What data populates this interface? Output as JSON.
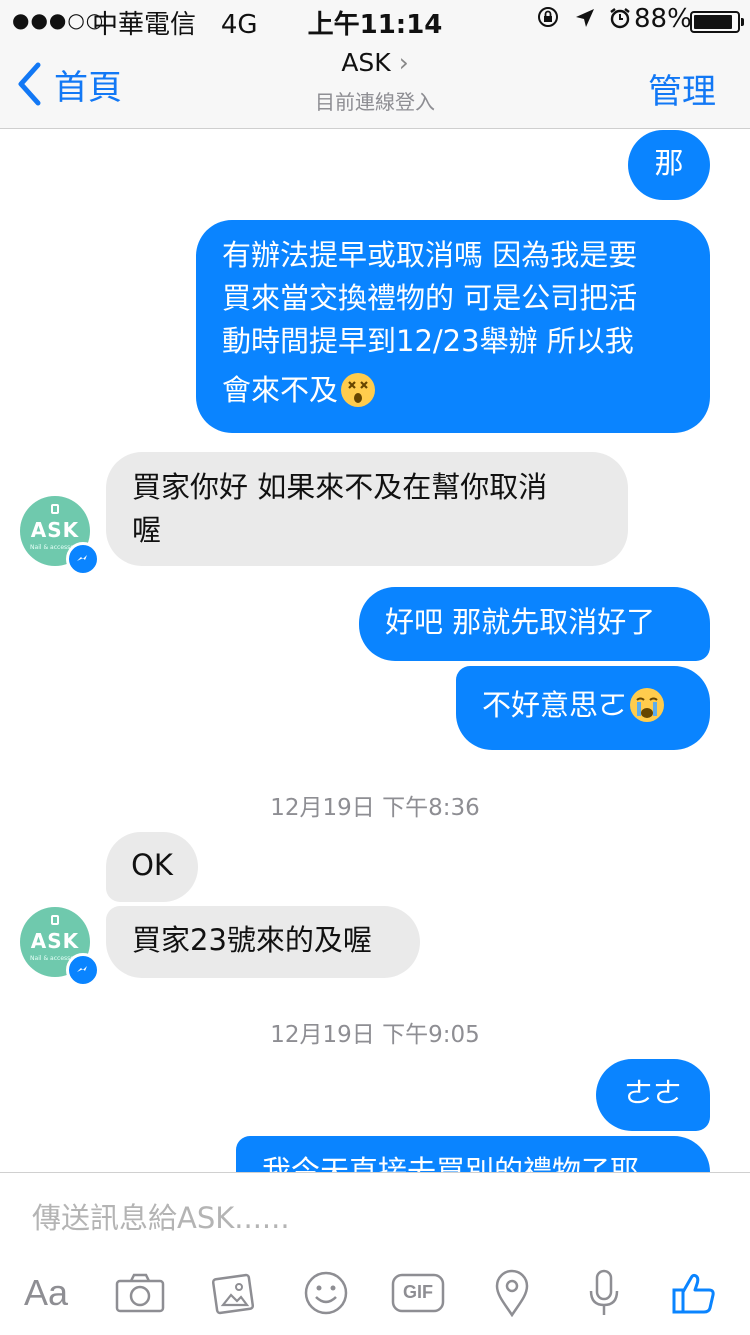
{
  "status_bar": {
    "signal": "●●●○○",
    "carrier": "中華電信",
    "network": "4G",
    "time": "上午11:14",
    "battery": "88%"
  },
  "nav": {
    "back_label": "首頁",
    "title": "ASK",
    "subtitle": "目前連線登入",
    "manage_label": "管理"
  },
  "messages": [
    {
      "dir": "out",
      "text": "那"
    },
    {
      "dir": "out",
      "lines": [
        "有辦法提早或取消嗎 因為我是要",
        "買來當交換禮物的 可是公司把活",
        "動時間提早到12/23舉辦 所以我",
        "會來不及"
      ],
      "emoji": "dizzy-face"
    },
    {
      "dir": "in",
      "lines": [
        "買家你好  如果來不及在幫你取消",
        "喔"
      ]
    },
    {
      "dir": "out",
      "text": "好吧 那就先取消好了"
    },
    {
      "dir": "out",
      "text": "不好意思ㄛ",
      "emoji": "crying-face"
    },
    {
      "timestamp": "12月19日 下午8:36"
    },
    {
      "dir": "in",
      "text": "OK"
    },
    {
      "dir": "in",
      "text": "買家23號來的及喔"
    },
    {
      "timestamp": "12月19日 下午9:05"
    },
    {
      "dir": "out",
      "text": "ㄜㄜ"
    },
    {
      "dir": "out",
      "text": "我今天直接去買別的禮物了耶"
    }
  ],
  "avatar": {
    "label": "ASK",
    "sublabel": "Nail & accessory"
  },
  "composer": {
    "placeholder": "傳送訊息給ASK......",
    "toolbar": [
      "Aa",
      "camera-icon",
      "photo-icon",
      "emoji-icon",
      "GIF",
      "location-icon",
      "microphone-icon",
      "thumbs-up-icon"
    ]
  },
  "colors": {
    "accent": "#0a84ff",
    "link": "#1278f5",
    "incoming_bubble": "#eaeaea",
    "avatar": "#6fc9ad"
  }
}
